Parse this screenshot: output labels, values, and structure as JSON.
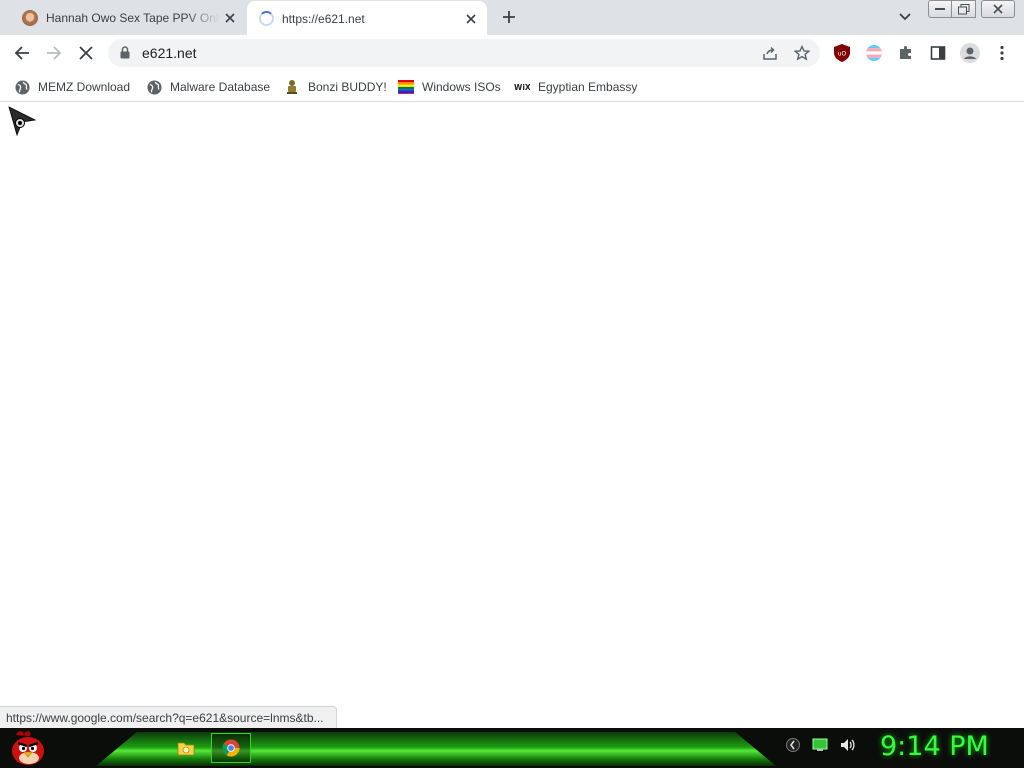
{
  "tabs": [
    {
      "title": "Hannah Owo Sex Tape PPV OnlyFans",
      "favicon": "avatar-face-icon",
      "active": false
    },
    {
      "title": "https://e621.net",
      "favicon": "loading-spinner-icon",
      "active": true
    }
  ],
  "toolbar": {
    "url": "e621.net",
    "extensions": [
      "ublock-origin-icon",
      "flag-extension-icon",
      "puzzle-extensions-icon"
    ]
  },
  "bookmarks": [
    {
      "label": "MEMZ Download",
      "icon": "globe-icon"
    },
    {
      "label": "Malware Database",
      "icon": "globe-icon"
    },
    {
      "label": "Bonzi BUDDY!",
      "icon": "bonzi-icon"
    },
    {
      "label": "Windows ISOs",
      "icon": "rainbow-flag-icon"
    },
    {
      "label": "Egyptian Embassy",
      "icon": "wix-icon"
    }
  ],
  "status_url": "https://www.google.com/search?q=e621&source=lnms&tb...",
  "taskbar": {
    "clock": "9:14 PM",
    "apps": [
      "file-explorer-icon",
      "chrome-icon"
    ]
  },
  "colors": {
    "tabstrip": "#dee1e6",
    "taskbar_green": "#35ff3c",
    "ublock_red": "#800000"
  }
}
